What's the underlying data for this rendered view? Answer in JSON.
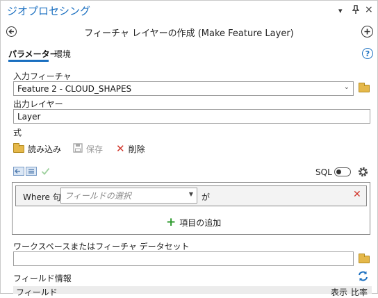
{
  "pane": {
    "title": "ジオプロセシング"
  },
  "tool": {
    "title": "フィーチャ レイヤーの作成 (Make Feature Layer)"
  },
  "tabs": [
    {
      "label": "パラメーター"
    },
    {
      "label": "環境"
    }
  ],
  "help": {
    "glyph": "?"
  },
  "params": {
    "input_label": "入力フィーチャ",
    "input_value": "Feature 2 - CLOUD_SHAPES",
    "output_label": "出力レイヤー",
    "output_value": "Layer",
    "expression_label": "式"
  },
  "expression": {
    "load": "読み込み",
    "save": "保存",
    "delete": "削除",
    "sql": "SQL",
    "where": "Where 句",
    "field_placeholder": "フィールドの選択",
    "operator": "が",
    "add_clause": "項目の追加"
  },
  "workspace": {
    "label": "ワークスペースまたはフィーチャ データセット",
    "value": ""
  },
  "field_info": {
    "label": "フィールド情報",
    "col_field": "フィールド",
    "col_visible": "表示",
    "col_ratio": "比率"
  },
  "colors": {
    "accent": "#1a6fc0",
    "delete": "#d1362b",
    "add": "#2c9a2c",
    "folder": "#e5b84a"
  }
}
